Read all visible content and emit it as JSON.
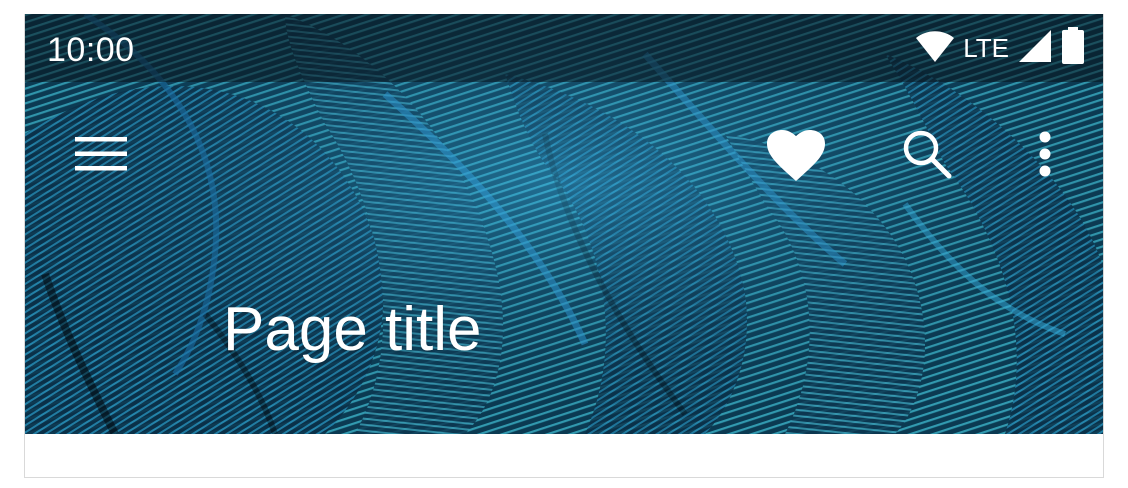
{
  "status_bar": {
    "time": "10:00",
    "network_label": "LTE",
    "icons": [
      "wifi-icon",
      "signal-icon",
      "battery-icon"
    ]
  },
  "app_bar": {
    "navigation_icon": "menu-icon",
    "actions": [
      "heart-icon",
      "search-icon",
      "more-vert-icon"
    ],
    "title": "Page title"
  },
  "colors": {
    "on_image": "#ffffff",
    "status_scrim": "#0a141c",
    "feather_base": "#0d3b55",
    "feather_light": "#36b6d8",
    "feather_mid": "#1d84b5",
    "surface": "#ffffff"
  }
}
